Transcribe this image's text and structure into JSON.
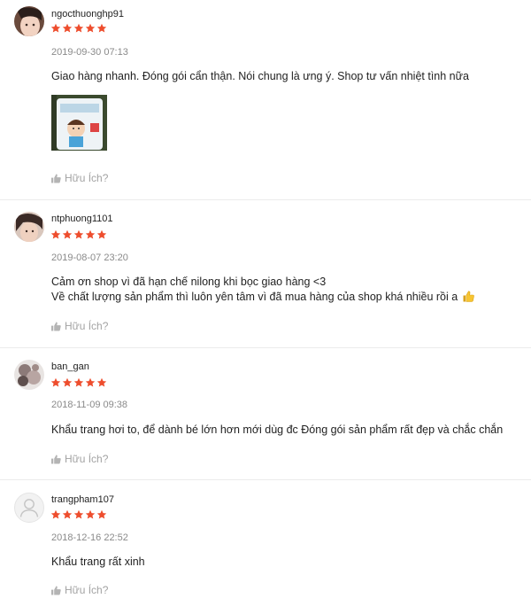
{
  "reviews": [
    {
      "username": "ngocthuonghp91",
      "rating": 5,
      "date": "2019-09-30 07:13",
      "text": "Giao hàng nhanh. Đóng gói cẩn thận. Nói chung là ưng ý. Shop tư vấn nhiệt tình nữa",
      "helpful": "Hữu Ích?"
    },
    {
      "username": "ntphuong1101",
      "rating": 5,
      "date": "2019-08-07 23:20",
      "text_line1": "Cảm ơn shop vì đã hạn chế nilong khi bọc giao hàng <3",
      "text_line2": "Về chất lượng sản phẩm thì luôn yên tâm vì đã mua hàng của shop khá nhiều rồi a",
      "helpful": "Hữu Ích?"
    },
    {
      "username": "ban_gan",
      "rating": 5,
      "date": "2018-11-09 09:38",
      "text": "Khẩu trang hơi to, để dành bé lớn hơn mới dùg đc Đóng gói sản phẩm rất đẹp và chắc chắn",
      "helpful": "Hữu Ích?"
    },
    {
      "username": "trangpham107",
      "rating": 5,
      "date": "2018-12-16 22:52",
      "text": "Khẩu trang rất xinh",
      "helpful": "Hữu Ích?"
    }
  ],
  "colors": {
    "star": "#ee4d2d",
    "muted": "#8a8a8a",
    "helpful": "#a3a3a3"
  },
  "icons": {
    "star": "star-icon",
    "thumb": "thumbs-up-icon",
    "default_avatar": "user-icon"
  }
}
